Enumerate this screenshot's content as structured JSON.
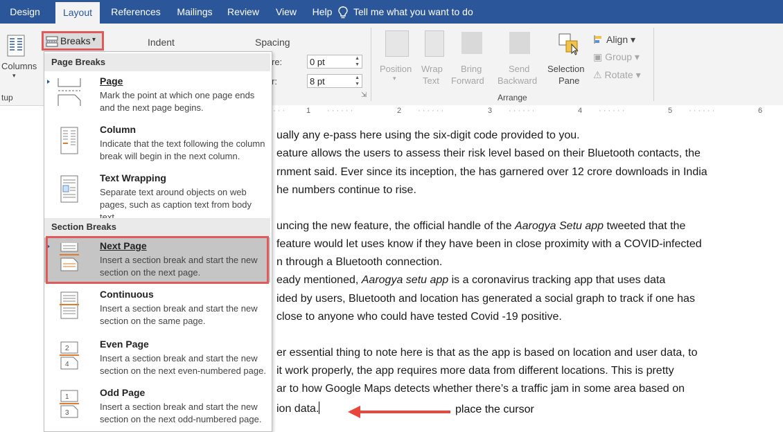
{
  "tabs": [
    "Design",
    "Layout",
    "References",
    "Mailings",
    "Review",
    "View",
    "Help"
  ],
  "tell_me": "Tell me what you want to do",
  "ribbon": {
    "breaks_label": "Breaks",
    "indent_label": "Indent",
    "spacing_label": "Spacing",
    "columns_label": "Columns",
    "setup_partial": "tup",
    "before_label": "re:",
    "before_value": "0 pt",
    "after_label": "r:",
    "after_value": "8 pt",
    "arrange": {
      "position": "Position",
      "wrap_text_1": "Wrap",
      "wrap_text_2": "Text",
      "bring_forward_1": "Bring",
      "bring_forward_2": "Forward",
      "send_backward_1": "Send",
      "send_backward_2": "Backward",
      "selection_pane_1": "Selection",
      "selection_pane_2": "Pane",
      "align": "Align",
      "group": "Group",
      "rotate": "Rotate",
      "group_label": "Arrange"
    }
  },
  "ruler_numbers": [
    "1",
    "2",
    "3",
    "4",
    "5",
    "6"
  ],
  "menu": {
    "page_breaks_header": "Page Breaks",
    "section_breaks_header": "Section Breaks",
    "items": [
      {
        "title": "Page",
        "desc": "Mark the point at which one page ends and the next page begins."
      },
      {
        "title": "Column",
        "desc": "Indicate that the text following the column break will begin in the next column."
      },
      {
        "title": "Text Wrapping",
        "desc": "Separate text around objects on web pages, such as caption text from body text."
      },
      {
        "title": "Next Page",
        "desc": "Insert a section break and start the new section on the next page."
      },
      {
        "title": "Continuous",
        "desc": "Insert a section break and start the new section on the same page."
      },
      {
        "title": "Even Page",
        "desc": "Insert a section break and start the new section on the next even-numbered page."
      },
      {
        "title": "Odd Page",
        "desc": "Insert a section break and start the new section on the next odd-numbered page."
      }
    ]
  },
  "document": {
    "lines": [
      "ually any e-pass here using the six-digit code provided to you.",
      "eature allows the users to assess their risk level based on their Bluetooth contacts, the",
      "rnment said. Ever since its inception, the has garnered over 12 crore downloads in India",
      "he numbers continue to rise.",
      "uncing the new feature, the official handle of the ",
      "feature would let uses know if they have been in close proximity with a COVID-infected",
      "n through a Bluetooth connection.",
      "eady mentioned, ",
      "ided by users, Bluetooth and location has generated a social graph to track if one has",
      "close to anyone who could have tested Covid -19 positive.",
      "er essential thing to note here is that as the app is based on location and user data, to",
      "it work properly, the app requires more data from different locations. This is pretty",
      "ar to how Google Maps detects whether there’s a traffic jam in some area based on",
      "ion data."
    ],
    "line5_italic": "Aarogya Setu app",
    "line5_tail": " tweeted that the",
    "line8_italic": "Aarogya setu app",
    "line8_tail": " is a coronavirus tracking app that uses data"
  },
  "annotation": "place the cursor",
  "colors": {
    "ribbon_blue": "#2b579a",
    "highlight_red": "#e05a5a",
    "arrow_red": "#e8453c"
  }
}
